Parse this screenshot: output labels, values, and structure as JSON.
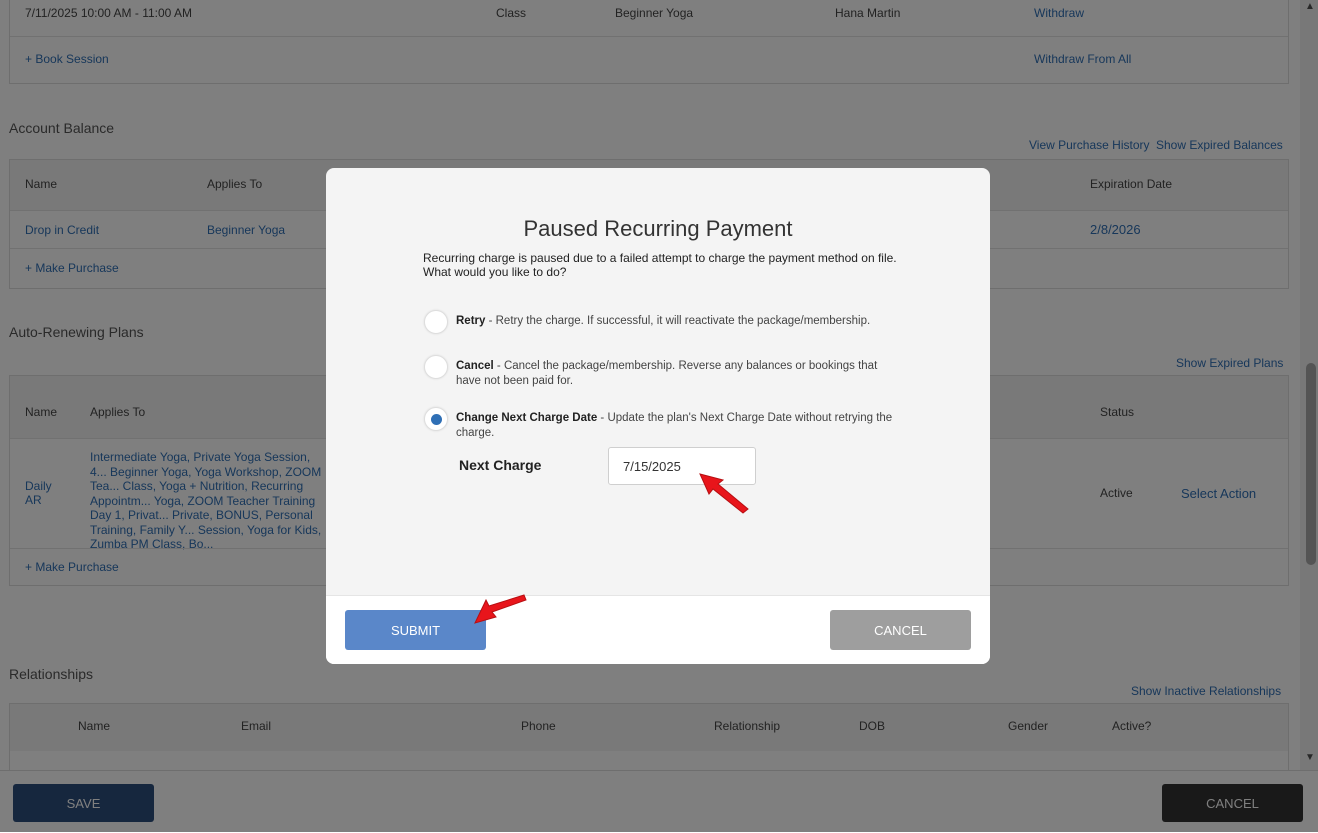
{
  "sessions": {
    "row": {
      "datetime": "7/11/2025 10:00 AM - 11:00 AM",
      "type": "Class",
      "name": "Beginner Yoga",
      "instructor": "Hana Martin",
      "action": "Withdraw"
    },
    "book": "+ Book Session",
    "withdraw_all": "Withdraw From All"
  },
  "account_balance": {
    "title": "Account Balance",
    "links": {
      "history": "View Purchase History",
      "expired": "Show Expired Balances"
    },
    "headers": {
      "name": "Name",
      "applies": "Applies To",
      "expiration": "Expiration Date"
    },
    "row": {
      "name": "Drop in Credit",
      "applies": "Beginner Yoga",
      "expiration": "2/8/2026"
    },
    "make_purchase": "+ Make Purchase"
  },
  "auto_renewing": {
    "title": "Auto-Renewing Plans",
    "link_expired": "Show Expired Plans",
    "headers": {
      "name": "Name",
      "applies": "Applies To",
      "status": "Status"
    },
    "row": {
      "name": "Daily AR",
      "applies": "Intermediate Yoga, Private Yoga Session, 4... Beginner Yoga, Yoga Workshop, ZOOM Tea... Class, Yoga + Nutrition, Recurring Appointm... Yoga, ZOOM Teacher Training Day 1, Privat... Private, BONUS, Personal Training, Family Y... Session, Yoga for Kids, Zumba PM Class, Bo...",
      "status": "Active",
      "action": "Select Action"
    },
    "make_purchase": "+ Make Purchase"
  },
  "relationships": {
    "title": "Relationships",
    "link": "Show Inactive Relationships",
    "headers": {
      "name": "Name",
      "email": "Email",
      "phone": "Phone",
      "relationship": "Relationship",
      "dob": "DOB",
      "gender": "Gender",
      "active": "Active?"
    }
  },
  "bottom": {
    "save": "SAVE",
    "cancel": "CANCEL"
  },
  "modal": {
    "title": "Paused Recurring Payment",
    "description": "Recurring charge is paused due to a failed attempt to charge the payment method on file. What would you like to do?",
    "options": [
      {
        "label": "Retry",
        "desc": " - Retry the charge. If successful, it will reactivate the package/membership.",
        "selected": false
      },
      {
        "label": "Cancel",
        "desc": " - Cancel the package/membership. Reverse any balances or bookings that have not been paid for.",
        "selected": false
      },
      {
        "label": "Change Next Charge Date",
        "desc": " - Update the plan's Next Charge Date without retrying the charge.",
        "selected": true
      }
    ],
    "next_charge_label": "Next Charge",
    "next_charge_value": "7/15/2025",
    "submit": "SUBMIT",
    "cancel": "CANCEL"
  },
  "colors": {
    "link": "#2f6fb5",
    "submit": "#5a87c9",
    "cancel": "#9e9e9e",
    "annotation_arrow": "#e8151b"
  }
}
